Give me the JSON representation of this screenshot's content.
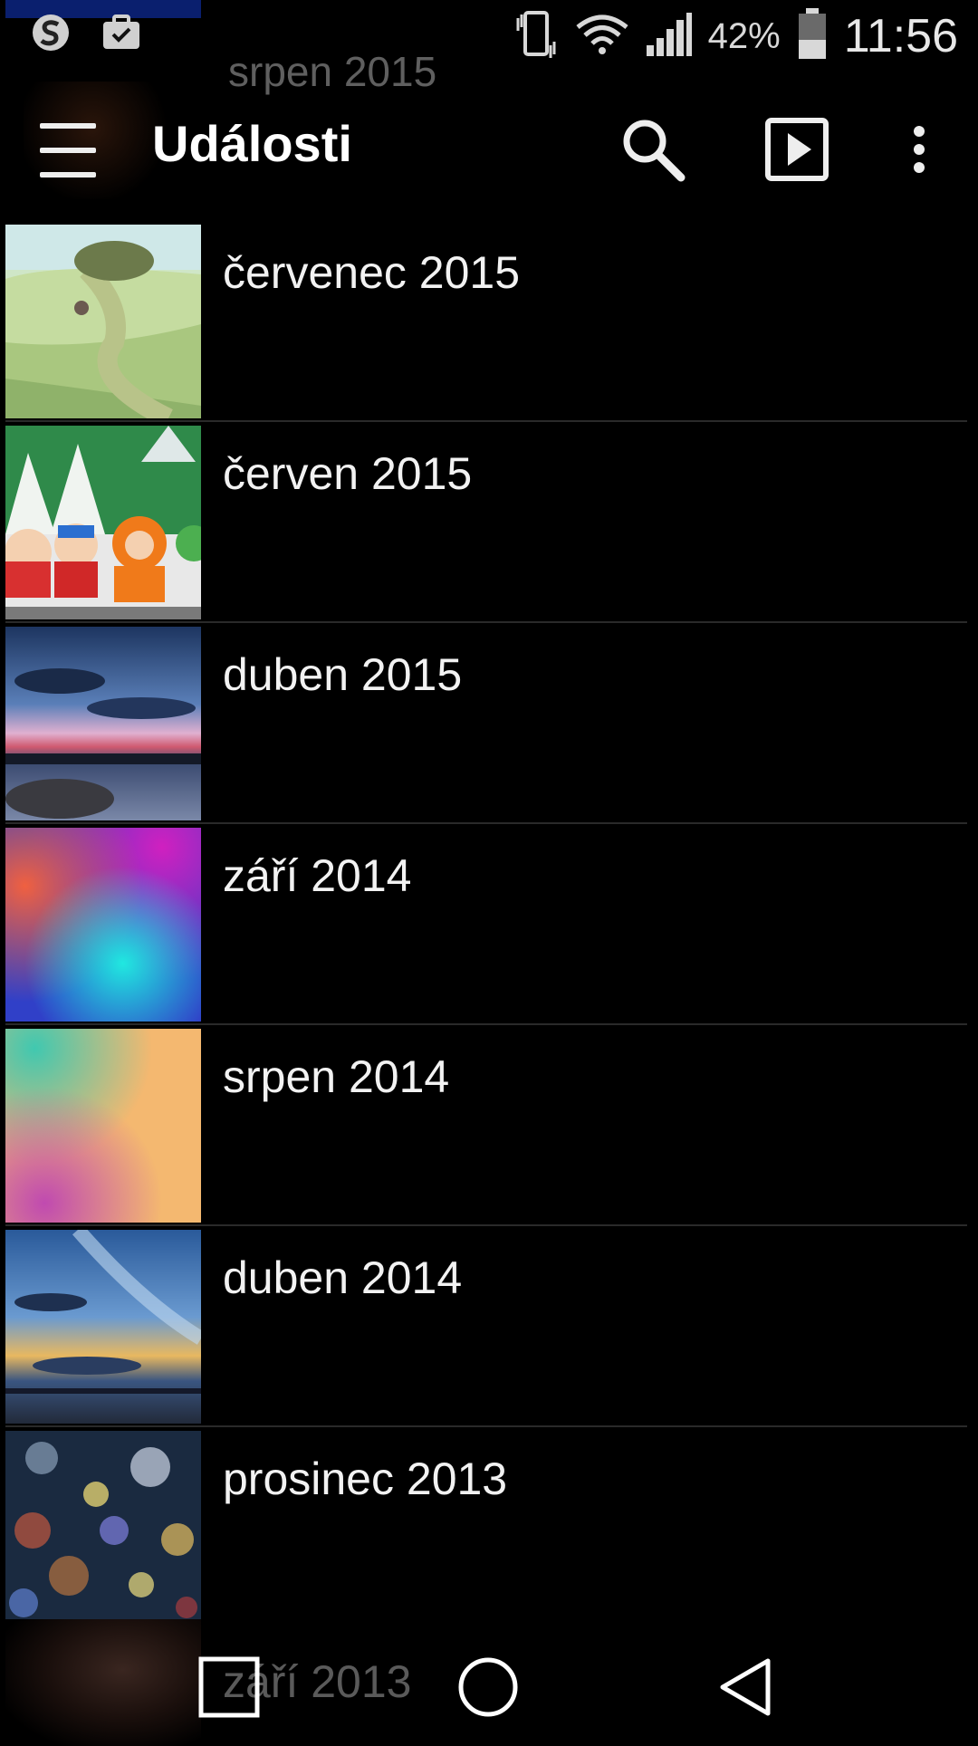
{
  "status_bar": {
    "battery_percent": "42%",
    "battery_level": 0.42,
    "time": "11:56",
    "icons": [
      "s-app-icon",
      "briefcase-icon",
      "vibrate-icon",
      "wifi-icon",
      "signal-icon",
      "battery-icon"
    ]
  },
  "app_bar": {
    "title": "Události",
    "actions": [
      "search-icon",
      "slideshow-icon",
      "more-icon"
    ]
  },
  "ghost_top_label": "srpen 2015",
  "events": [
    {
      "label": "červenec 2015",
      "thumb": "cartoon-landscape"
    },
    {
      "label": "červen 2015",
      "thumb": "cartoon-characters"
    },
    {
      "label": "duben 2015",
      "thumb": "sunset-lake"
    },
    {
      "label": "září 2014",
      "thumb": "gradient-magenta-cyan"
    },
    {
      "label": "srpen 2014",
      "thumb": "gradient-teal-peach"
    },
    {
      "label": "duben 2014",
      "thumb": "sky-sunset-beach"
    },
    {
      "label": "prosinec 2013",
      "thumb": "bokeh-lights"
    }
  ],
  "ghost_bottom_label": "září 2013",
  "nav_bar": {
    "buttons": [
      "recents-icon",
      "home-icon",
      "back-icon"
    ]
  },
  "colors": {
    "background": "#000000",
    "divider": "#2a2a2a",
    "text": "#f2f2f2",
    "ghost_text": "#5f5f5f"
  }
}
